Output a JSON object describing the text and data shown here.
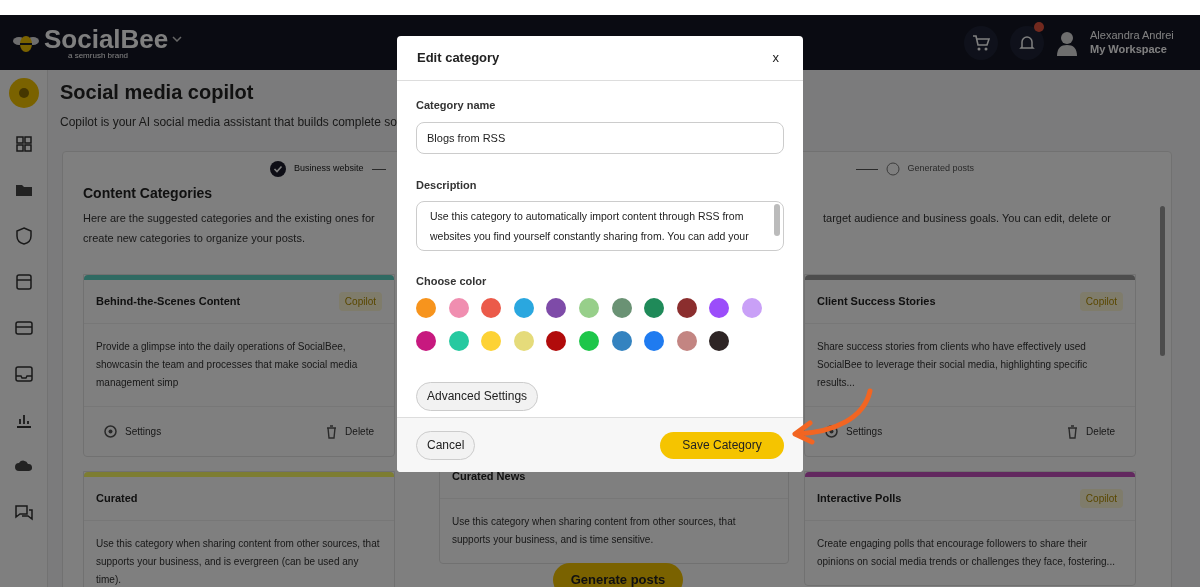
{
  "header": {
    "brand": "SocialBee",
    "tagline": "a semrush brand",
    "user_name": "Alexandra Andrei",
    "workspace": "My Workspace"
  },
  "page": {
    "title": "Social media copilot",
    "subtitle": "Copilot is your AI social media assistant that builds complete so"
  },
  "stepper": {
    "first": "Business website",
    "last": "Generated posts"
  },
  "categories_section": {
    "title": "Content Categories",
    "intro_left": "Here are the suggested categories and the existing ones for",
    "intro_left_2": "create new categories to organize your posts.",
    "intro_right": "target audience and business goals. You can edit, delete or"
  },
  "cards_left": [
    {
      "title": "Behind-the-Scenes Content",
      "badge": "Copilot",
      "color": "#2f6a62",
      "description": "Provide a glimpse into the daily operations of SocialBee, showcasin the team and processes that make social media management simp",
      "settings": "Settings",
      "delete": "Delete"
    },
    {
      "title": "Curated",
      "color": "#7d7d32",
      "description": "Use this category when sharing content from other sources, that supports your business, and is evergreen (can be used any time)."
    }
  ],
  "cards_middle": [
    {
      "title": "Curated News",
      "description": "Use this category when sharing content from other sources, that supports your business, and is time sensitive."
    }
  ],
  "cards_right": [
    {
      "title": "Client Success Stories",
      "badge": "Copilot",
      "color": "#4d4d4d",
      "description": "Share success stories from clients who have effectively used SocialBee to leverage their social media, highlighting specific results...",
      "settings": "Settings",
      "delete": "Delete"
    },
    {
      "title": "Interactive Polls",
      "badge": "Copilot",
      "color": "#62285f",
      "description": "Create engaging polls that encourage followers to share their opinions on social media trends or challenges they face, fostering..."
    }
  ],
  "generate_button": "Generate posts",
  "dialog": {
    "title": "Edit category",
    "close": "x",
    "name_label": "Category name",
    "name_value": "Blogs from RSS",
    "description_label": "Description",
    "description_value": "Use this category to automatically import content through RSS from websites you find yourself constantly sharing from. You can add your",
    "color_label": "Choose color",
    "colors": [
      {
        "color": "#f7941d"
      },
      {
        "color": "#f08eb0"
      },
      {
        "color": "#eb5a4a"
      },
      {
        "color": "#2aa7df"
      },
      {
        "color": "#7e4ba8"
      },
      {
        "color": "#97cf8a"
      },
      {
        "color": "#6a9274"
      },
      {
        "color": "#1f8a59"
      },
      {
        "color": "#8b2e2e"
      },
      {
        "color": "#9b4dfa"
      },
      {
        "color": "#c9a0f7"
      },
      {
        "color": "#c7197f"
      },
      {
        "color": "#26c9a0"
      },
      {
        "color": "#fdd235"
      },
      {
        "color": "#e5db7a"
      },
      {
        "color": "#b10b0b"
      },
      {
        "color": "#1ec64a"
      },
      {
        "color": "#3483c0"
      },
      {
        "color": "#1f7bf0"
      },
      {
        "color": "#c38582"
      },
      {
        "color": "#2e2525"
      }
    ],
    "advanced": "Advanced Settings",
    "cancel": "Cancel",
    "save": "Save Category"
  }
}
